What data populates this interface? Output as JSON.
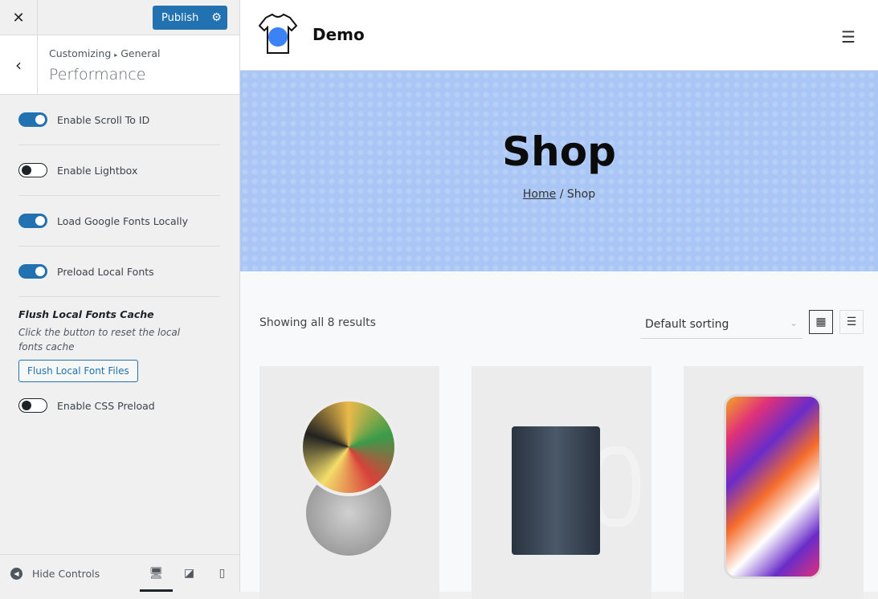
{
  "customizer": {
    "close_icon": "close-icon",
    "publish_label": "Publish",
    "breadcrumb_root": "Customizing",
    "breadcrumb_sep": "▸",
    "breadcrumb_section": "General",
    "section_title": "Performance",
    "options": [
      {
        "label": "Enable Scroll To ID",
        "on": true
      },
      {
        "label": "Enable Lightbox",
        "on": false
      },
      {
        "label": "Load Google Fonts Locally",
        "on": true
      },
      {
        "label": "Preload Local Fonts",
        "on": true
      }
    ],
    "flush": {
      "heading": "Flush Local Fonts Cache",
      "description": "Click the button to reset the local fonts cache",
      "button": "Flush Local Font Files"
    },
    "css_preload": {
      "label": "Enable CSS Preload",
      "on": false
    },
    "footer": {
      "hide_controls": "Hide Controls",
      "active_device": "desktop"
    },
    "accent": "#2271b1"
  },
  "preview": {
    "site_name": "Demo",
    "hero_title": "Shop",
    "breadcrumb_home": "Home",
    "breadcrumb_sep": " / ",
    "breadcrumb_current": "Shop",
    "result_count": "Showing all 8 results",
    "sorting": "Default sorting",
    "active_view": "grid",
    "hero_color": "#aac6f5"
  }
}
